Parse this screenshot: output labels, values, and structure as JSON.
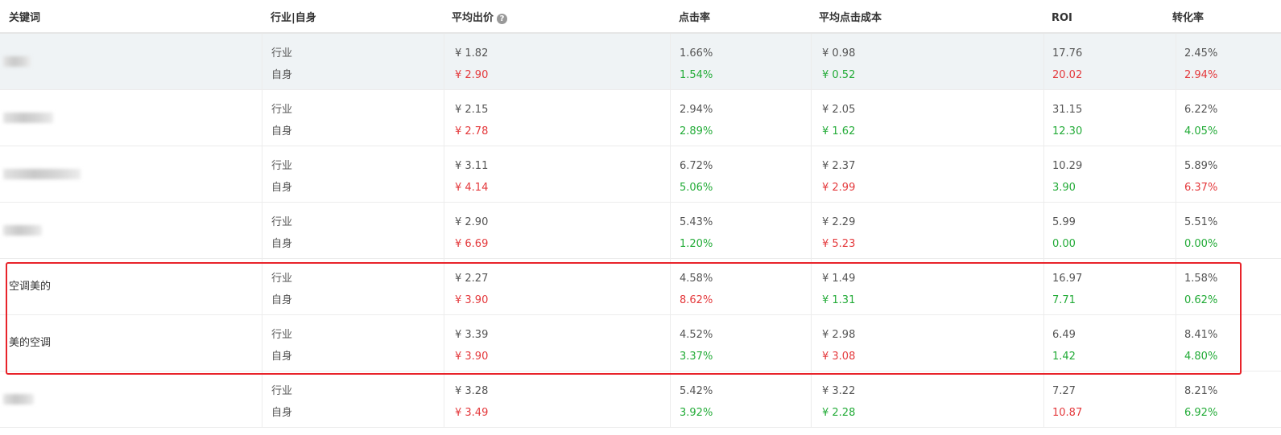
{
  "headers": {
    "keyword": "关键词",
    "compare": "行业|自身",
    "avg_bid": "平均出价",
    "ctr": "点击率",
    "avg_cpc": "平均点击成本",
    "roi": "ROI",
    "cvr": "转化率"
  },
  "labels": {
    "industry": "行业",
    "self": "自身"
  },
  "icons": {
    "help": "question-circle-icon"
  },
  "colors": {
    "higher": "#e4393c",
    "lower": "#22ab37",
    "highlight_border": "#e8232a"
  },
  "rows": [
    {
      "keyword": "",
      "keyword_blurred": true,
      "industry": {
        "avg_bid": "¥ 1.82",
        "ctr": "1.66%",
        "avg_cpc": "¥ 0.98",
        "roi": "17.76",
        "cvr": "2.45%"
      },
      "self": {
        "avg_bid": "¥ 2.90",
        "ctr": "1.54%",
        "avg_cpc": "¥ 0.52",
        "roi": "20.02",
        "cvr": "2.94%"
      },
      "self_color": {
        "avg_bid": "red",
        "ctr": "green",
        "avg_cpc": "green",
        "roi": "red",
        "cvr": "red"
      }
    },
    {
      "keyword": "",
      "keyword_blurred": true,
      "industry": {
        "avg_bid": "¥ 2.15",
        "ctr": "2.94%",
        "avg_cpc": "¥ 2.05",
        "roi": "31.15",
        "cvr": "6.22%"
      },
      "self": {
        "avg_bid": "¥ 2.78",
        "ctr": "2.89%",
        "avg_cpc": "¥ 1.62",
        "roi": "12.30",
        "cvr": "4.05%"
      },
      "self_color": {
        "avg_bid": "red",
        "ctr": "green",
        "avg_cpc": "green",
        "roi": "green",
        "cvr": "green"
      }
    },
    {
      "keyword": "",
      "keyword_blurred": true,
      "industry": {
        "avg_bid": "¥ 3.11",
        "ctr": "6.72%",
        "avg_cpc": "¥ 2.37",
        "roi": "10.29",
        "cvr": "5.89%"
      },
      "self": {
        "avg_bid": "¥ 4.14",
        "ctr": "5.06%",
        "avg_cpc": "¥ 2.99",
        "roi": "3.90",
        "cvr": "6.37%"
      },
      "self_color": {
        "avg_bid": "red",
        "ctr": "green",
        "avg_cpc": "red",
        "roi": "green",
        "cvr": "red"
      }
    },
    {
      "keyword": "",
      "keyword_blurred": true,
      "industry": {
        "avg_bid": "¥ 2.90",
        "ctr": "5.43%",
        "avg_cpc": "¥ 2.29",
        "roi": "5.99",
        "cvr": "5.51%"
      },
      "self": {
        "avg_bid": "¥ 6.69",
        "ctr": "1.20%",
        "avg_cpc": "¥ 5.23",
        "roi": "0.00",
        "cvr": "0.00%"
      },
      "self_color": {
        "avg_bid": "red",
        "ctr": "green",
        "avg_cpc": "red",
        "roi": "green",
        "cvr": "green"
      }
    },
    {
      "keyword": "空调美的",
      "keyword_blurred": false,
      "industry": {
        "avg_bid": "¥ 2.27",
        "ctr": "4.58%",
        "avg_cpc": "¥ 1.49",
        "roi": "16.97",
        "cvr": "1.58%"
      },
      "self": {
        "avg_bid": "¥ 3.90",
        "ctr": "8.62%",
        "avg_cpc": "¥ 1.31",
        "roi": "7.71",
        "cvr": "0.62%"
      },
      "self_color": {
        "avg_bid": "red",
        "ctr": "red",
        "avg_cpc": "green",
        "roi": "green",
        "cvr": "green"
      }
    },
    {
      "keyword": "美的空调",
      "keyword_blurred": false,
      "industry": {
        "avg_bid": "¥ 3.39",
        "ctr": "4.52%",
        "avg_cpc": "¥ 2.98",
        "roi": "6.49",
        "cvr": "8.41%"
      },
      "self": {
        "avg_bid": "¥ 3.90",
        "ctr": "3.37%",
        "avg_cpc": "¥ 3.08",
        "roi": "1.42",
        "cvr": "4.80%"
      },
      "self_color": {
        "avg_bid": "red",
        "ctr": "green",
        "avg_cpc": "red",
        "roi": "green",
        "cvr": "green"
      }
    },
    {
      "keyword": "",
      "keyword_blurred": true,
      "industry": {
        "avg_bid": "¥ 3.28",
        "ctr": "5.42%",
        "avg_cpc": "¥ 3.22",
        "roi": "7.27",
        "cvr": "8.21%"
      },
      "self": {
        "avg_bid": "¥ 3.49",
        "ctr": "3.92%",
        "avg_cpc": "¥ 2.28",
        "roi": "10.87",
        "cvr": "6.92%"
      },
      "self_color": {
        "avg_bid": "red",
        "ctr": "green",
        "avg_cpc": "green",
        "roi": "red",
        "cvr": "green"
      }
    }
  ]
}
